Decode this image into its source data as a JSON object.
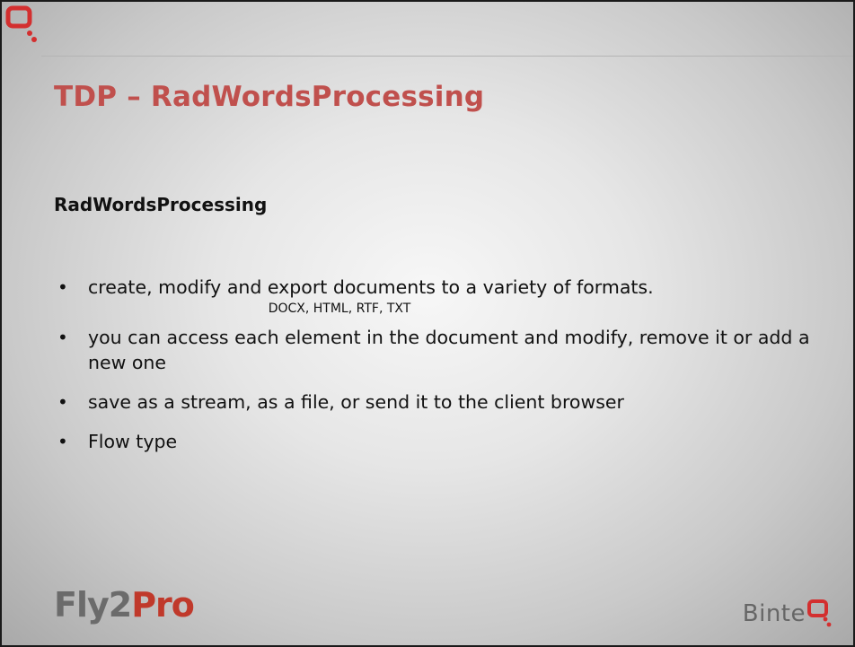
{
  "slide": {
    "title": "TDP – RadWordsProcessing",
    "subheading": "RadWordsProcessing",
    "bullets": [
      "create, modify and export documents to a variety of formats.",
      "you can access each element in the document and modify, remove it or add a new one",
      "save as a stream, as a file, or send it to the client browser",
      "Flow type"
    ],
    "formats_line": "DOCX, HTML, RTF, TXT",
    "bullet_symbol": "•"
  },
  "branding": {
    "left_logo_part1": "Fly2",
    "left_logo_part2": "Pro",
    "right_logo_text": "Binte",
    "corner_icon": "binteq-q-icon"
  },
  "colors": {
    "title": "#c0504d",
    "accent_red": "#c0392b",
    "logo_gray": "#6b6b6b"
  }
}
